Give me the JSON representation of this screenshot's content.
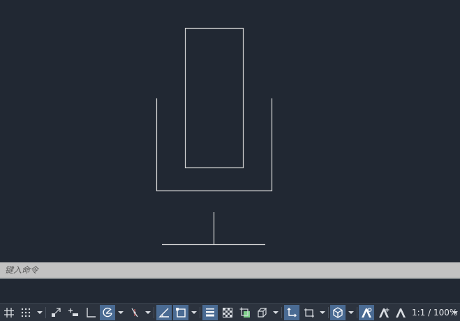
{
  "canvas": {
    "background": "#212833",
    "line_color": "#d8d8d8"
  },
  "command_line": {
    "placeholder": "键入命令",
    "value": ""
  },
  "status_bar": {
    "zoom_label": "1:1 / 100%",
    "active_color": "#4a6b93",
    "items": [
      {
        "name": "grid-icon",
        "active": false
      },
      {
        "name": "snap-dots-icon",
        "active": false
      },
      {
        "name": "snap-dropdown-icon",
        "active": false
      },
      {
        "name": "infer-constraints-icon",
        "active": false
      },
      {
        "name": "dynamic-input-icon",
        "active": false
      },
      {
        "name": "ortho-icon",
        "active": false
      },
      {
        "name": "polar-tracking-icon",
        "active": true
      },
      {
        "name": "polar-dropdown-icon",
        "active": false
      },
      {
        "name": "isometric-icon",
        "active": false
      },
      {
        "name": "isometric-dropdown-icon",
        "active": false
      },
      {
        "name": "object-snap-tracking-icon",
        "active": true
      },
      {
        "name": "object-snap-icon",
        "active": true
      },
      {
        "name": "object-snap-dropdown-icon",
        "active": false
      },
      {
        "name": "lineweight-icon",
        "active": true
      },
      {
        "name": "transparency-icon",
        "active": false
      },
      {
        "name": "selection-cycling-icon",
        "active": false
      },
      {
        "name": "3d-object-snap-icon",
        "active": false
      },
      {
        "name": "3d-snap-dropdown-icon",
        "active": false
      },
      {
        "name": "dynamic-ucs-icon",
        "active": true
      },
      {
        "name": "selection-filter-icon",
        "active": false
      },
      {
        "name": "selection-filter-dropdown-icon",
        "active": false
      },
      {
        "name": "gizmo-icon",
        "active": true
      },
      {
        "name": "gizmo-dropdown-icon",
        "active": false
      },
      {
        "name": "annotation-visibility-icon",
        "active": true
      },
      {
        "name": "auto-scale-icon",
        "active": false
      },
      {
        "name": "annotation-scale-icon",
        "active": false
      }
    ]
  }
}
